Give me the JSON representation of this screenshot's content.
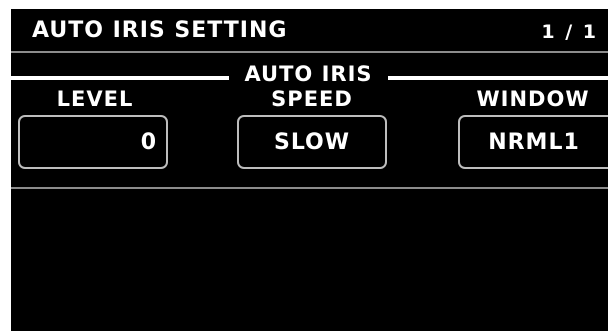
{
  "header": {
    "title": "AUTO IRIS SETTING",
    "page_indicator": "1 / 1"
  },
  "group": {
    "title": "AUTO IRIS"
  },
  "params": {
    "level": {
      "label": "LEVEL",
      "value": "0"
    },
    "speed": {
      "label": "SPEED",
      "value": "SLOW"
    },
    "window": {
      "label": "WINDOW",
      "value": "NRML1"
    }
  },
  "colors": {
    "background": "#000000",
    "text": "#ffffff",
    "divider": "#8c8c8c",
    "box_border": "#bdbdbd"
  }
}
